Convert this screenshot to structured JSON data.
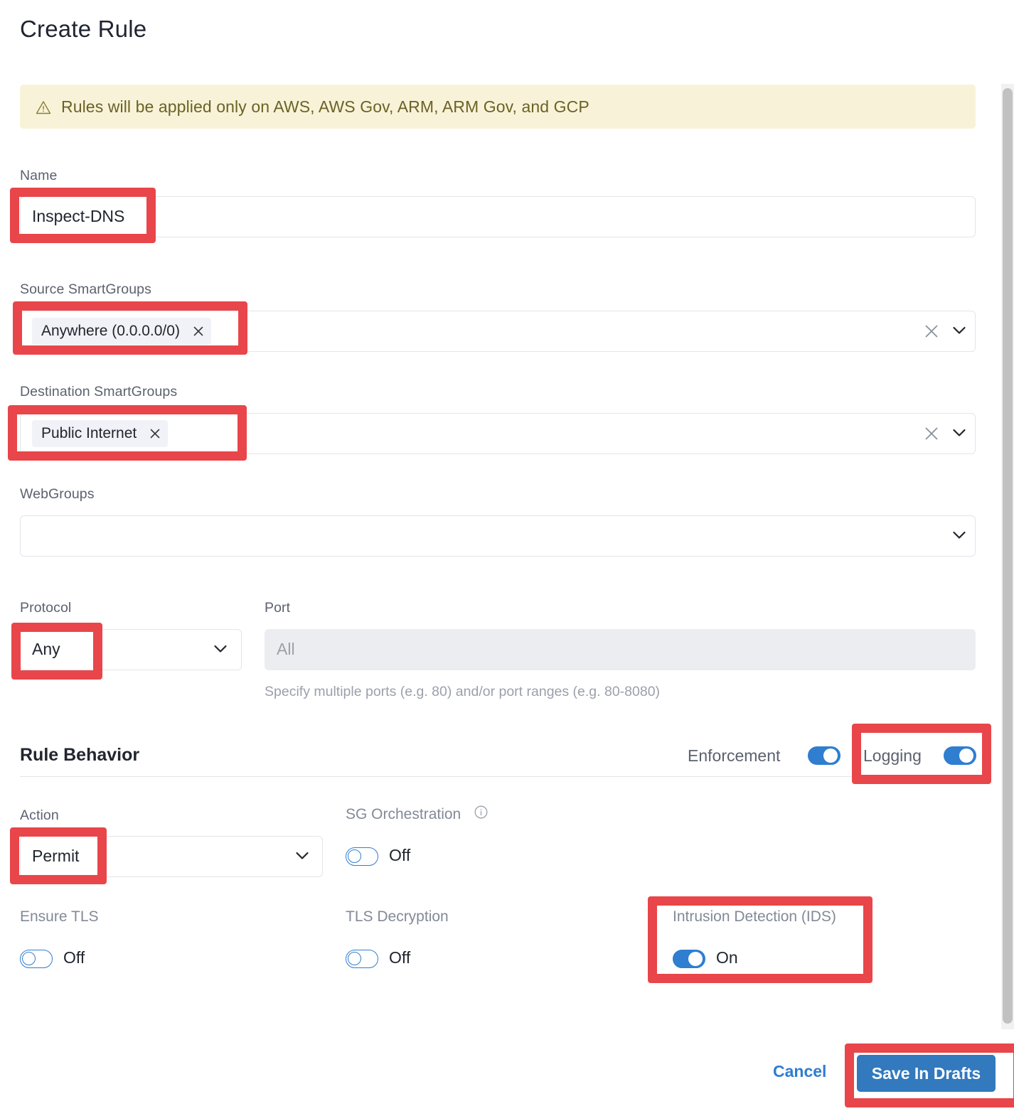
{
  "dialog": {
    "title": "Create Rule"
  },
  "banner": {
    "icon": "warning-triangle-icon",
    "message": "Rules will be applied only on AWS, AWS Gov, ARM, ARM Gov, and GCP",
    "background_color": "#f8f3d8",
    "text_color": "#6b6226"
  },
  "form": {
    "name": {
      "label": "Name",
      "value": "Inspect-DNS",
      "placeholder": ""
    },
    "source_smartgroups": {
      "label": "Source SmartGroups",
      "chips": [
        "Anywhere (0.0.0.0/0)"
      ],
      "chip_remove_icon": "×",
      "clear_icon": "clear-icon",
      "caret_icon": "chevron-down-icon"
    },
    "destination_smartgroups": {
      "label": "Destination SmartGroups",
      "chips": [
        "Public Internet"
      ],
      "chip_remove_icon": "×",
      "clear_icon": "clear-icon",
      "caret_icon": "chevron-down-icon"
    },
    "webgroups": {
      "label": "WebGroups",
      "value": "",
      "caret_icon": "chevron-down-icon"
    },
    "protocol": {
      "label": "Protocol",
      "value": "Any",
      "caret_icon": "chevron-down-icon"
    },
    "port": {
      "label": "Port",
      "placeholder": "All",
      "helper": "Specify multiple ports (e.g. 80) and/or port ranges (e.g. 80-8080)",
      "disabled": true
    }
  },
  "rule_behavior": {
    "title": "Rule Behavior",
    "enforcement": {
      "label": "Enforcement",
      "state": "on"
    },
    "logging": {
      "label": "Logging",
      "state": "on"
    },
    "action": {
      "label": "Action",
      "value": "Permit",
      "caret_icon": "chevron-down-icon"
    },
    "sg_orchestration": {
      "label": "SG Orchestration",
      "info_icon": "info-circle-icon",
      "state_label": "Off",
      "state": "off"
    },
    "ensure_tls": {
      "label": "Ensure TLS",
      "state_label": "Off",
      "state": "off"
    },
    "tls_decryption": {
      "label": "TLS Decryption",
      "state_label": "Off",
      "state": "off"
    },
    "intrusion_detection": {
      "label": "Intrusion Detection (IDS)",
      "state_label": "On",
      "state": "on"
    }
  },
  "footer": {
    "cancel_label": "Cancel",
    "save_label": "Save In Drafts",
    "primary_color": "#3279bd"
  },
  "annotations": {
    "highlight_color": "#e8464a",
    "boxes": [
      "name-field",
      "source-smartgroup-chip",
      "destination-smartgroup-chip",
      "protocol-select",
      "logging-toggle",
      "action-select",
      "intrusion-detection-toggle",
      "save-in-drafts-button"
    ]
  }
}
